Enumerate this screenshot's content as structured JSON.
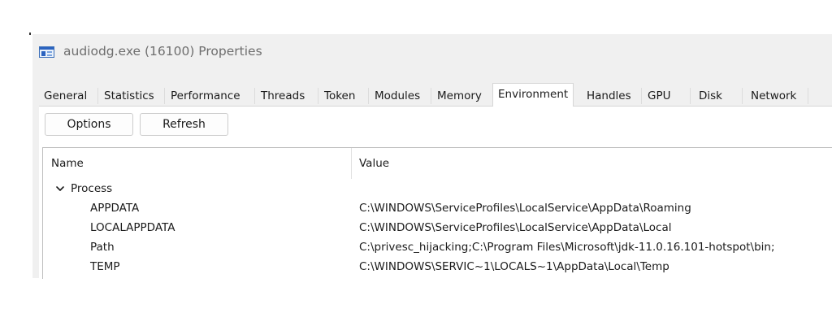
{
  "window": {
    "title": "audiodg.exe (16100) Properties",
    "icon": "window-app-icon"
  },
  "tabs": [
    {
      "label": "General",
      "active": false
    },
    {
      "label": "Statistics",
      "active": false
    },
    {
      "label": "Performance",
      "active": false
    },
    {
      "label": "Threads",
      "active": false
    },
    {
      "label": "Token",
      "active": false
    },
    {
      "label": "Modules",
      "active": false
    },
    {
      "label": "Memory",
      "active": false
    },
    {
      "label": "Environment",
      "active": true
    },
    {
      "label": "Handles",
      "active": false
    },
    {
      "label": "GPU",
      "active": false
    },
    {
      "label": "Disk",
      "active": false
    },
    {
      "label": "Network",
      "active": false
    }
  ],
  "toolbar": {
    "options_label": "Options",
    "refresh_label": "Refresh"
  },
  "list": {
    "columns": {
      "name": "Name",
      "value": "Value"
    },
    "group": {
      "label": "Process",
      "expanded": true,
      "icon": "chevron-down-icon"
    },
    "rows": [
      {
        "name": "APPDATA",
        "value": "C:\\WINDOWS\\ServiceProfiles\\LocalService\\AppData\\Roaming"
      },
      {
        "name": "LOCALAPPDATA",
        "value": "C:\\WINDOWS\\ServiceProfiles\\LocalService\\AppData\\Local"
      },
      {
        "name": "Path",
        "value": "C:\\privesc_hijacking;C:\\Program Files\\Microsoft\\jdk-11.0.16.101-hotspot\\bin;"
      },
      {
        "name": "TEMP",
        "value": "C:\\WINDOWS\\SERVIC~1\\LOCALS~1\\AppData\\Local\\Temp"
      }
    ]
  },
  "colors": {
    "window_bg": "#f0f0f0",
    "content_bg": "#ffffff",
    "title_text": "#6e6e6e",
    "icon_accent": "#2b63c0"
  }
}
